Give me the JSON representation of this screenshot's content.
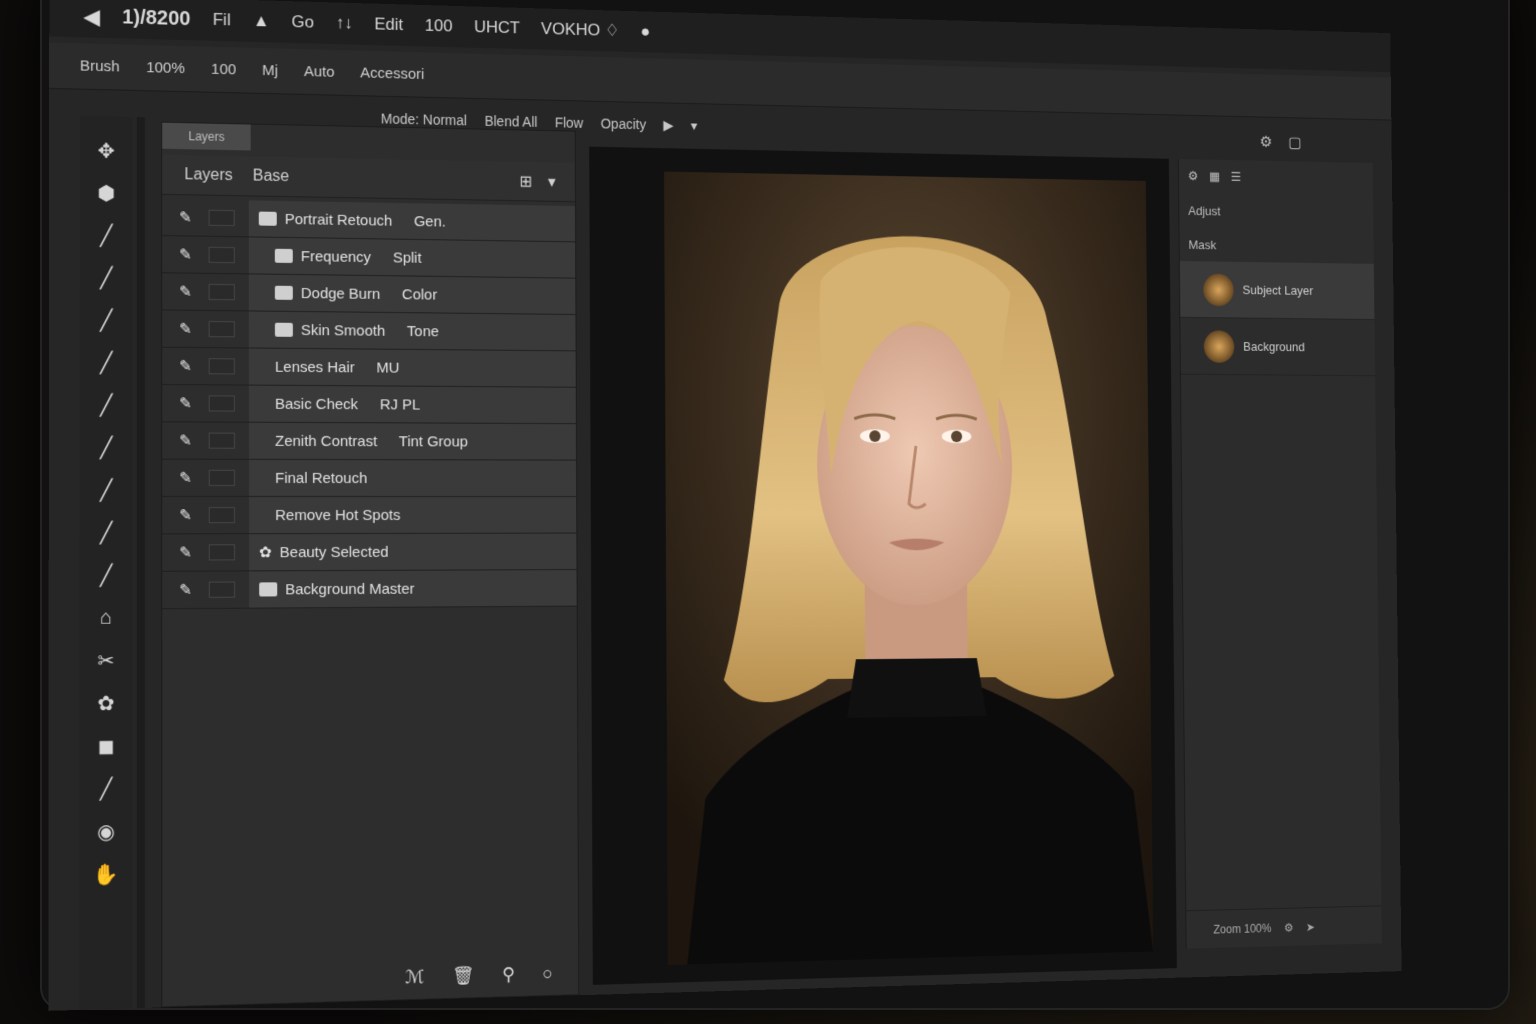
{
  "menubar": {
    "items": [
      "◀",
      "1)/8200",
      "Fil",
      "▲",
      "Go",
      "↑↓",
      "Edit",
      "100",
      "UHCT",
      "VOKHO ♢",
      "●"
    ]
  },
  "optionsbar": {
    "items": [
      "Brush",
      "100%",
      "100",
      "Mj",
      "Auto",
      "Accessori"
    ],
    "row2": [
      "Mode: Normal",
      "Blend All",
      "Flow",
      "Opacity"
    ]
  },
  "tools": [
    "move-icon",
    "lasso-icon",
    "brush-icon",
    "brush-icon",
    "brush-icon",
    "brush-icon",
    "brush-icon",
    "brush-icon",
    "brush-icon",
    "brush-icon",
    "brush-icon",
    "stamp-icon",
    "crop-icon",
    "eraser-icon",
    "bucket-icon",
    "pen-icon",
    "zoom-icon",
    "hand-icon",
    "text-icon"
  ],
  "layers_panel": {
    "tab_label": "Layers",
    "header_left": "Layers",
    "header_title": "Base",
    "layers": [
      {
        "name": "Portrait Retouch",
        "extra": "Gen."
      },
      {
        "name": "Frequency",
        "extra": "Split"
      },
      {
        "name": "Dodge Burn",
        "extra": "Color"
      },
      {
        "name": "Skin Smooth",
        "extra": "Tone"
      },
      {
        "name": "Lenses Hair",
        "extra": "MU"
      },
      {
        "name": "Basic Check",
        "extra": "RJ PL"
      },
      {
        "name": "Zenith Contrast",
        "extra": "Tint Group"
      },
      {
        "name": "Final Retouch",
        "extra": ""
      },
      {
        "name": "Remove Hot Spots",
        "extra": ""
      },
      {
        "name": "Beauty Selected",
        "extra": ""
      },
      {
        "name": "Background Master",
        "extra": ""
      }
    ],
    "footer_icons": [
      "fx-icon",
      "delete-icon",
      "search-icon",
      "circle-icon"
    ]
  },
  "right_panel": {
    "rows": [
      "Adjust",
      "Mask"
    ],
    "layers": [
      {
        "name": "Subject Layer",
        "selected": true
      },
      {
        "name": "Background",
        "selected": false
      }
    ],
    "footer": "Zoom 100%"
  },
  "colors": {
    "ui_dark": "#262626",
    "panel": "#2d2d2d",
    "highlight": "#3a3a3a",
    "hair": "#d8b574",
    "accent_thumb": "#d9a55b"
  }
}
